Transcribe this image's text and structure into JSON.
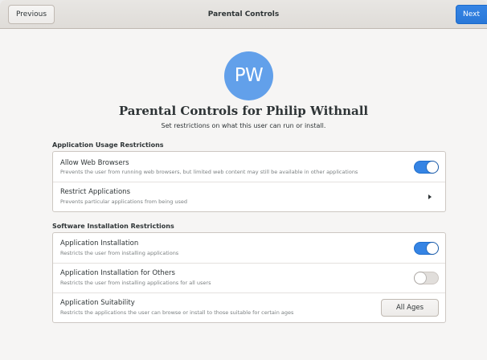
{
  "header": {
    "title": "Parental Controls",
    "previous_label": "Previous",
    "next_label": "Next"
  },
  "user": {
    "initials": "PW",
    "avatar_color": "#62a0ea"
  },
  "page": {
    "title": "Parental Controls for Philip Withnall",
    "subtitle": "Set restrictions on what this user can run or install."
  },
  "usage_section": {
    "header": "Application Usage Restrictions",
    "rows": [
      {
        "title": "Allow Web Browsers",
        "subtitle": "Prevents the user from running web browsers, but limited web content may still be available in other applications",
        "control": "switch",
        "state": "on"
      },
      {
        "title": "Restrict Applications",
        "subtitle": "Prevents particular applications from being used",
        "control": "arrow",
        "icon": "pan-end-icon"
      }
    ]
  },
  "install_section": {
    "header": "Software Installation Restrictions",
    "rows": [
      {
        "title": "Application Installation",
        "subtitle": "Restricts the user from installing applications",
        "control": "switch",
        "state": "on"
      },
      {
        "title": "Application Installation for Others",
        "subtitle": "Restricts the user from installing applications for all users",
        "control": "switch",
        "state": "off"
      },
      {
        "title": "Application Suitability",
        "subtitle": "Restricts the applications the user can browse or install to those suitable for certain ages",
        "control": "combo",
        "value": "All Ages"
      }
    ]
  },
  "colors": {
    "accent": "#3584e4",
    "switch_off": "#e1dedb"
  }
}
